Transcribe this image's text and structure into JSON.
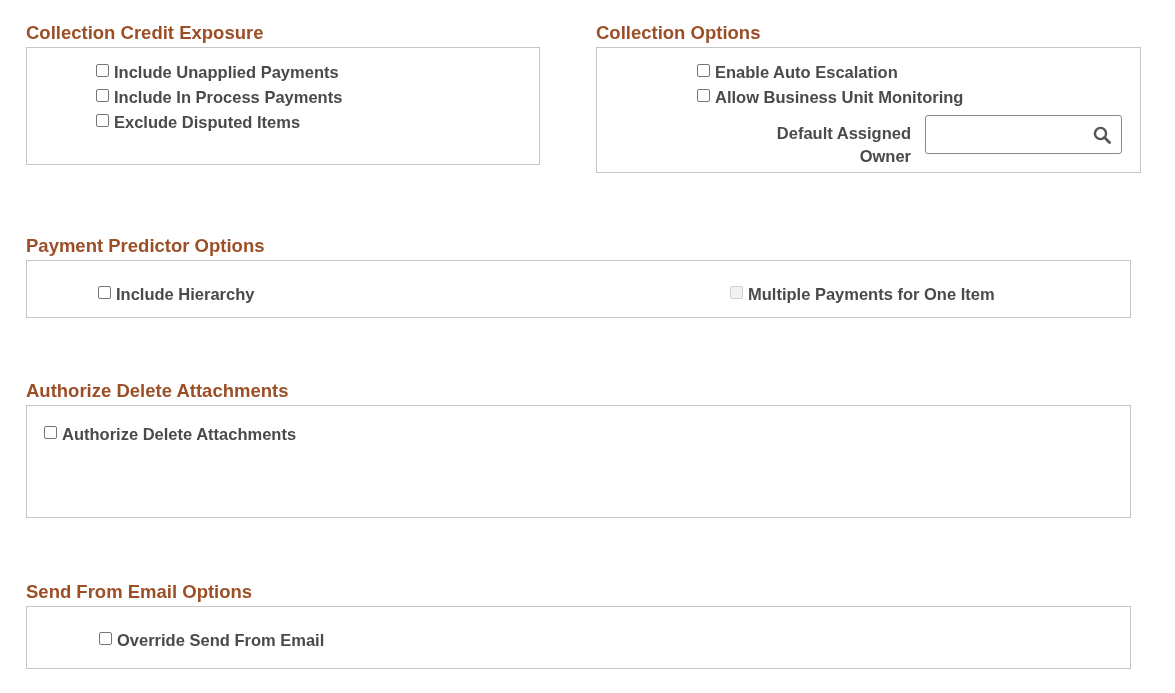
{
  "sections": [
    {
      "title": "Collection Credit Exposure",
      "items": [
        {
          "kind": "checkbox",
          "label": "Include Unapplied Payments",
          "checked": false,
          "disabled": false
        },
        {
          "kind": "checkbox",
          "label": "Include In Process Payments",
          "checked": false,
          "disabled": false
        },
        {
          "kind": "checkbox",
          "label": "Exclude Disputed Items",
          "checked": false,
          "disabled": false
        }
      ]
    },
    {
      "title": "Collection Options",
      "items": [
        {
          "kind": "checkbox",
          "label": "Enable Auto Escalation",
          "checked": false,
          "disabled": false
        },
        {
          "kind": "checkbox",
          "label": "Allow Business Unit Monitoring",
          "checked": false,
          "disabled": false
        },
        {
          "kind": "lookup",
          "label": "Default Assigned Owner"
        }
      ]
    },
    {
      "title": "Payment Predictor Options",
      "items": [
        {
          "kind": "checkbox",
          "label": "Include Hierarchy",
          "checked": false,
          "disabled": false
        },
        {
          "kind": "checkbox",
          "label": "Multiple Payments for One Item",
          "checked": false,
          "disabled": true
        }
      ]
    },
    {
      "title": "Authorize Delete Attachments",
      "items": [
        {
          "kind": "checkbox",
          "label": "Authorize Delete Attachments",
          "checked": false,
          "disabled": false
        }
      ]
    },
    {
      "title": "Send From Email Options",
      "items": [
        {
          "kind": "checkbox",
          "label": "Override Send From Email",
          "checked": false,
          "disabled": false
        }
      ]
    }
  ]
}
